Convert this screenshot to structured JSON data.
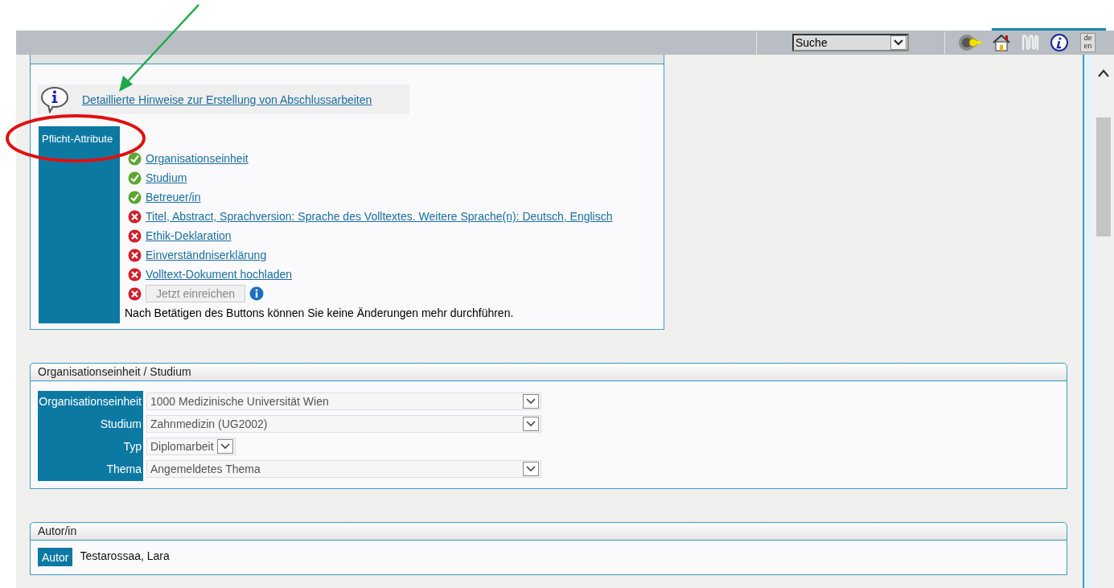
{
  "toolbar": {
    "search_select": "Suche",
    "language_toggle": [
      "de",
      "en"
    ]
  },
  "checklist": {
    "info_link": "Detaillierte Hinweise zur Erstellung von Abschlussarbeiten",
    "section_label": "Pflicht-Attribute",
    "items": [
      {
        "kind": "link",
        "label": "Organisationseinheit",
        "done": true
      },
      {
        "kind": "link",
        "label": "Studium",
        "done": true
      },
      {
        "kind": "link",
        "label": "Betreuer/in",
        "done": true
      },
      {
        "kind": "link",
        "label": "Titel, Abstract, Sprachversion: Sprache des Volltextes. Weitere Sprache(n): Deutsch, Englisch",
        "done": false
      },
      {
        "kind": "link",
        "label": "Ethik-Deklaration",
        "done": false
      },
      {
        "kind": "link",
        "label": "Einverständniserklärung",
        "done": false
      },
      {
        "kind": "link",
        "label": "Volltext-Dokument hochladen",
        "done": false
      },
      {
        "kind": "button",
        "label": "Jetzt einreichen",
        "done": false,
        "disabled": true
      }
    ],
    "note": "Nach Betätigen des Buttons können Sie keine Änderungen mehr durchführen."
  },
  "org_panel": {
    "title": "Organisationseinheit / Studium",
    "fields": [
      {
        "kind": "wide",
        "label": "Organisationseinheit",
        "value": "1000 Medizinische Universität Wien"
      },
      {
        "kind": "wide",
        "label": "Studium",
        "value": "Zahnmedizin (UG2002)"
      },
      {
        "kind": "narrow",
        "label": "Typ",
        "value": "Diplomarbeit"
      },
      {
        "kind": "wide",
        "label": "Thema",
        "value": "Angemeldetes Thema"
      }
    ]
  },
  "author_panel": {
    "title": "Autor/in",
    "label": "Autor",
    "value": "Testarossaa, Lara"
  }
}
